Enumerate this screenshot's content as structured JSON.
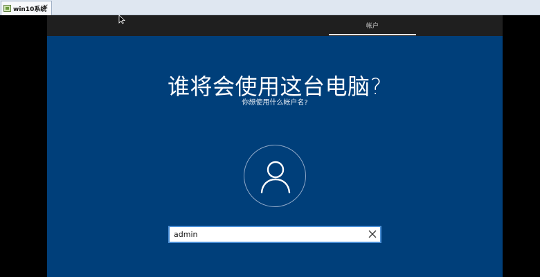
{
  "vm_window": {
    "tab_title": "win10系统",
    "tab_close_glyph": "✕"
  },
  "setup": {
    "step_label": "帐户",
    "title": "谁将会使用这台电脑?",
    "subtitle": "你想使用什么帐户名?",
    "username_value": "admin",
    "avatar_icon": "user-icon",
    "clear_icon": "close-icon"
  },
  "colors": {
    "screen_background": "#003f7a",
    "top_strip": "#1f1f1f",
    "input_border": "#4a8fd6"
  }
}
